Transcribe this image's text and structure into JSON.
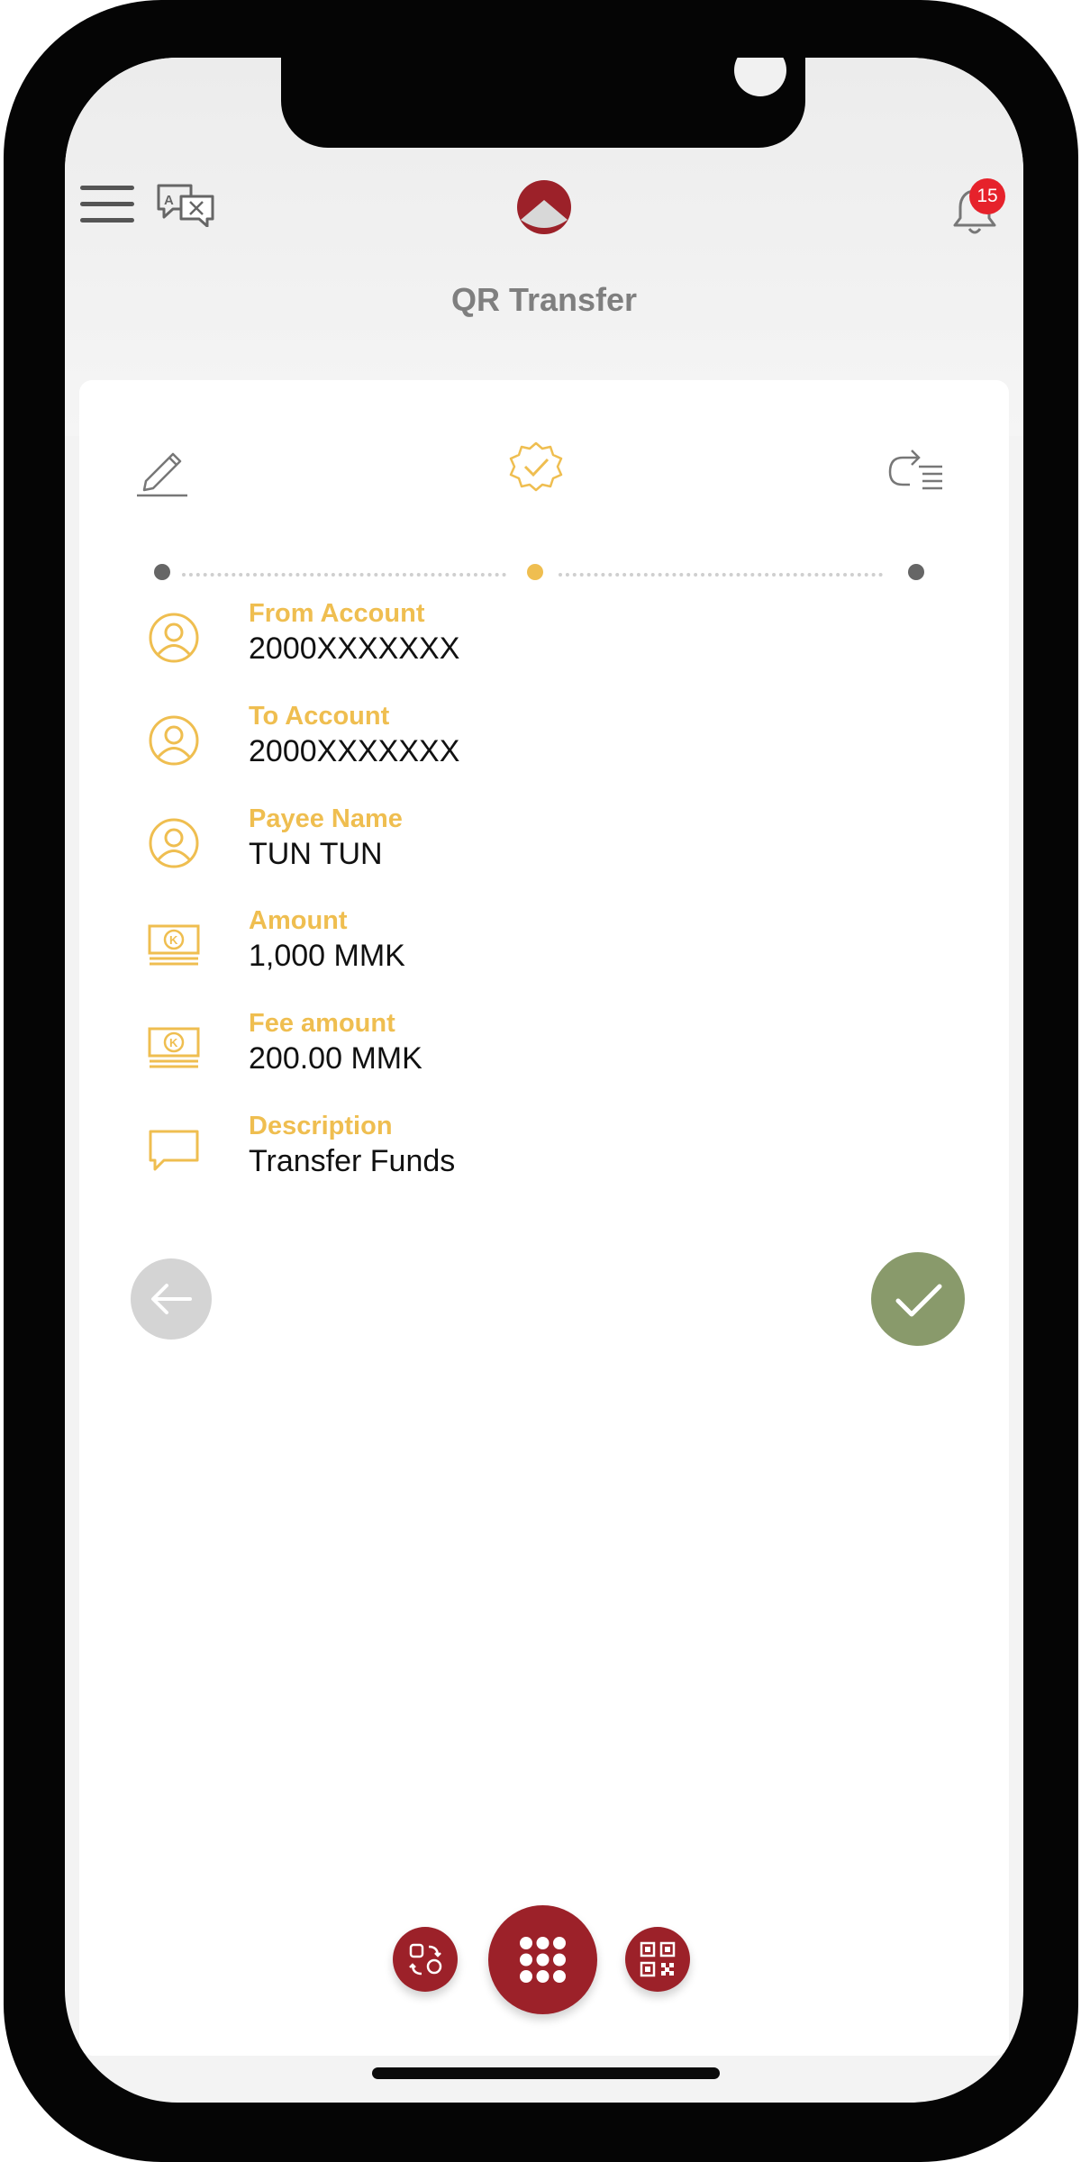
{
  "header": {
    "title": "QR Transfer",
    "notification_count": "15"
  },
  "steps": [
    {
      "name": "edit",
      "icon": "pencil-icon",
      "state": "done"
    },
    {
      "name": "confirm",
      "icon": "verified-badge-icon",
      "state": "active"
    },
    {
      "name": "result",
      "icon": "list-arrow-icon",
      "state": "pending"
    }
  ],
  "details": {
    "from_account": {
      "label": "From Account",
      "value": "2000XXXXXXX",
      "icon": "user-circle-icon"
    },
    "to_account": {
      "label": "To Account",
      "value": "2000XXXXXXX",
      "icon": "user-circle-icon"
    },
    "payee_name": {
      "label": "Payee Name",
      "value": "TUN TUN",
      "icon": "user-circle-icon"
    },
    "amount": {
      "label": "Amount",
      "value": "1,000 MMK",
      "icon": "banknote-icon"
    },
    "fee_amount": {
      "label": "Fee amount",
      "value": "200.00 MMK",
      "icon": "banknote-icon"
    },
    "description": {
      "label": "Description",
      "value": "Transfer Funds",
      "icon": "chat-bubble-icon"
    }
  },
  "colors": {
    "brand": "#9c2129",
    "label": "#efbe50",
    "confirm": "#899a6b",
    "active_step": "#efbe50"
  }
}
